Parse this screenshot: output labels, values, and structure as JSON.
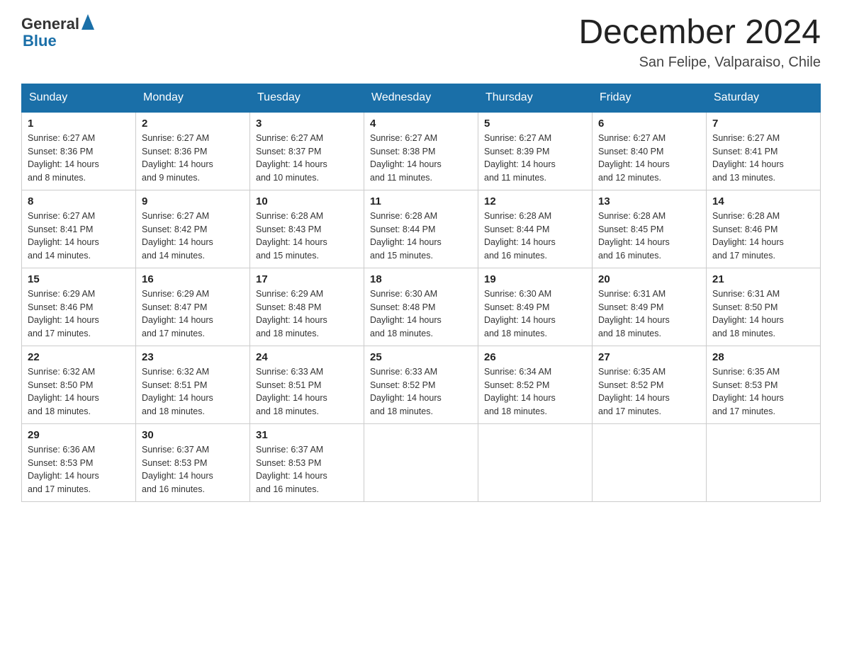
{
  "header": {
    "logo_general": "General",
    "logo_blue": "Blue",
    "month_title": "December 2024",
    "location": "San Felipe, Valparaiso, Chile"
  },
  "weekdays": [
    "Sunday",
    "Monday",
    "Tuesday",
    "Wednesday",
    "Thursday",
    "Friday",
    "Saturday"
  ],
  "weeks": [
    [
      {
        "day": "1",
        "sunrise": "6:27 AM",
        "sunset": "8:36 PM",
        "daylight": "14 hours and 8 minutes."
      },
      {
        "day": "2",
        "sunrise": "6:27 AM",
        "sunset": "8:36 PM",
        "daylight": "14 hours and 9 minutes."
      },
      {
        "day": "3",
        "sunrise": "6:27 AM",
        "sunset": "8:37 PM",
        "daylight": "14 hours and 10 minutes."
      },
      {
        "day": "4",
        "sunrise": "6:27 AM",
        "sunset": "8:38 PM",
        "daylight": "14 hours and 11 minutes."
      },
      {
        "day": "5",
        "sunrise": "6:27 AM",
        "sunset": "8:39 PM",
        "daylight": "14 hours and 11 minutes."
      },
      {
        "day": "6",
        "sunrise": "6:27 AM",
        "sunset": "8:40 PM",
        "daylight": "14 hours and 12 minutes."
      },
      {
        "day": "7",
        "sunrise": "6:27 AM",
        "sunset": "8:41 PM",
        "daylight": "14 hours and 13 minutes."
      }
    ],
    [
      {
        "day": "8",
        "sunrise": "6:27 AM",
        "sunset": "8:41 PM",
        "daylight": "14 hours and 14 minutes."
      },
      {
        "day": "9",
        "sunrise": "6:27 AM",
        "sunset": "8:42 PM",
        "daylight": "14 hours and 14 minutes."
      },
      {
        "day": "10",
        "sunrise": "6:28 AM",
        "sunset": "8:43 PM",
        "daylight": "14 hours and 15 minutes."
      },
      {
        "day": "11",
        "sunrise": "6:28 AM",
        "sunset": "8:44 PM",
        "daylight": "14 hours and 15 minutes."
      },
      {
        "day": "12",
        "sunrise": "6:28 AM",
        "sunset": "8:44 PM",
        "daylight": "14 hours and 16 minutes."
      },
      {
        "day": "13",
        "sunrise": "6:28 AM",
        "sunset": "8:45 PM",
        "daylight": "14 hours and 16 minutes."
      },
      {
        "day": "14",
        "sunrise": "6:28 AM",
        "sunset": "8:46 PM",
        "daylight": "14 hours and 17 minutes."
      }
    ],
    [
      {
        "day": "15",
        "sunrise": "6:29 AM",
        "sunset": "8:46 PM",
        "daylight": "14 hours and 17 minutes."
      },
      {
        "day": "16",
        "sunrise": "6:29 AM",
        "sunset": "8:47 PM",
        "daylight": "14 hours and 17 minutes."
      },
      {
        "day": "17",
        "sunrise": "6:29 AM",
        "sunset": "8:48 PM",
        "daylight": "14 hours and 18 minutes."
      },
      {
        "day": "18",
        "sunrise": "6:30 AM",
        "sunset": "8:48 PM",
        "daylight": "14 hours and 18 minutes."
      },
      {
        "day": "19",
        "sunrise": "6:30 AM",
        "sunset": "8:49 PM",
        "daylight": "14 hours and 18 minutes."
      },
      {
        "day": "20",
        "sunrise": "6:31 AM",
        "sunset": "8:49 PM",
        "daylight": "14 hours and 18 minutes."
      },
      {
        "day": "21",
        "sunrise": "6:31 AM",
        "sunset": "8:50 PM",
        "daylight": "14 hours and 18 minutes."
      }
    ],
    [
      {
        "day": "22",
        "sunrise": "6:32 AM",
        "sunset": "8:50 PM",
        "daylight": "14 hours and 18 minutes."
      },
      {
        "day": "23",
        "sunrise": "6:32 AM",
        "sunset": "8:51 PM",
        "daylight": "14 hours and 18 minutes."
      },
      {
        "day": "24",
        "sunrise": "6:33 AM",
        "sunset": "8:51 PM",
        "daylight": "14 hours and 18 minutes."
      },
      {
        "day": "25",
        "sunrise": "6:33 AM",
        "sunset": "8:52 PM",
        "daylight": "14 hours and 18 minutes."
      },
      {
        "day": "26",
        "sunrise": "6:34 AM",
        "sunset": "8:52 PM",
        "daylight": "14 hours and 18 minutes."
      },
      {
        "day": "27",
        "sunrise": "6:35 AM",
        "sunset": "8:52 PM",
        "daylight": "14 hours and 17 minutes."
      },
      {
        "day": "28",
        "sunrise": "6:35 AM",
        "sunset": "8:53 PM",
        "daylight": "14 hours and 17 minutes."
      }
    ],
    [
      {
        "day": "29",
        "sunrise": "6:36 AM",
        "sunset": "8:53 PM",
        "daylight": "14 hours and 17 minutes."
      },
      {
        "day": "30",
        "sunrise": "6:37 AM",
        "sunset": "8:53 PM",
        "daylight": "14 hours and 16 minutes."
      },
      {
        "day": "31",
        "sunrise": "6:37 AM",
        "sunset": "8:53 PM",
        "daylight": "14 hours and 16 minutes."
      },
      null,
      null,
      null,
      null
    ]
  ],
  "labels": {
    "sunrise": "Sunrise:",
    "sunset": "Sunset:",
    "daylight": "Daylight:"
  }
}
